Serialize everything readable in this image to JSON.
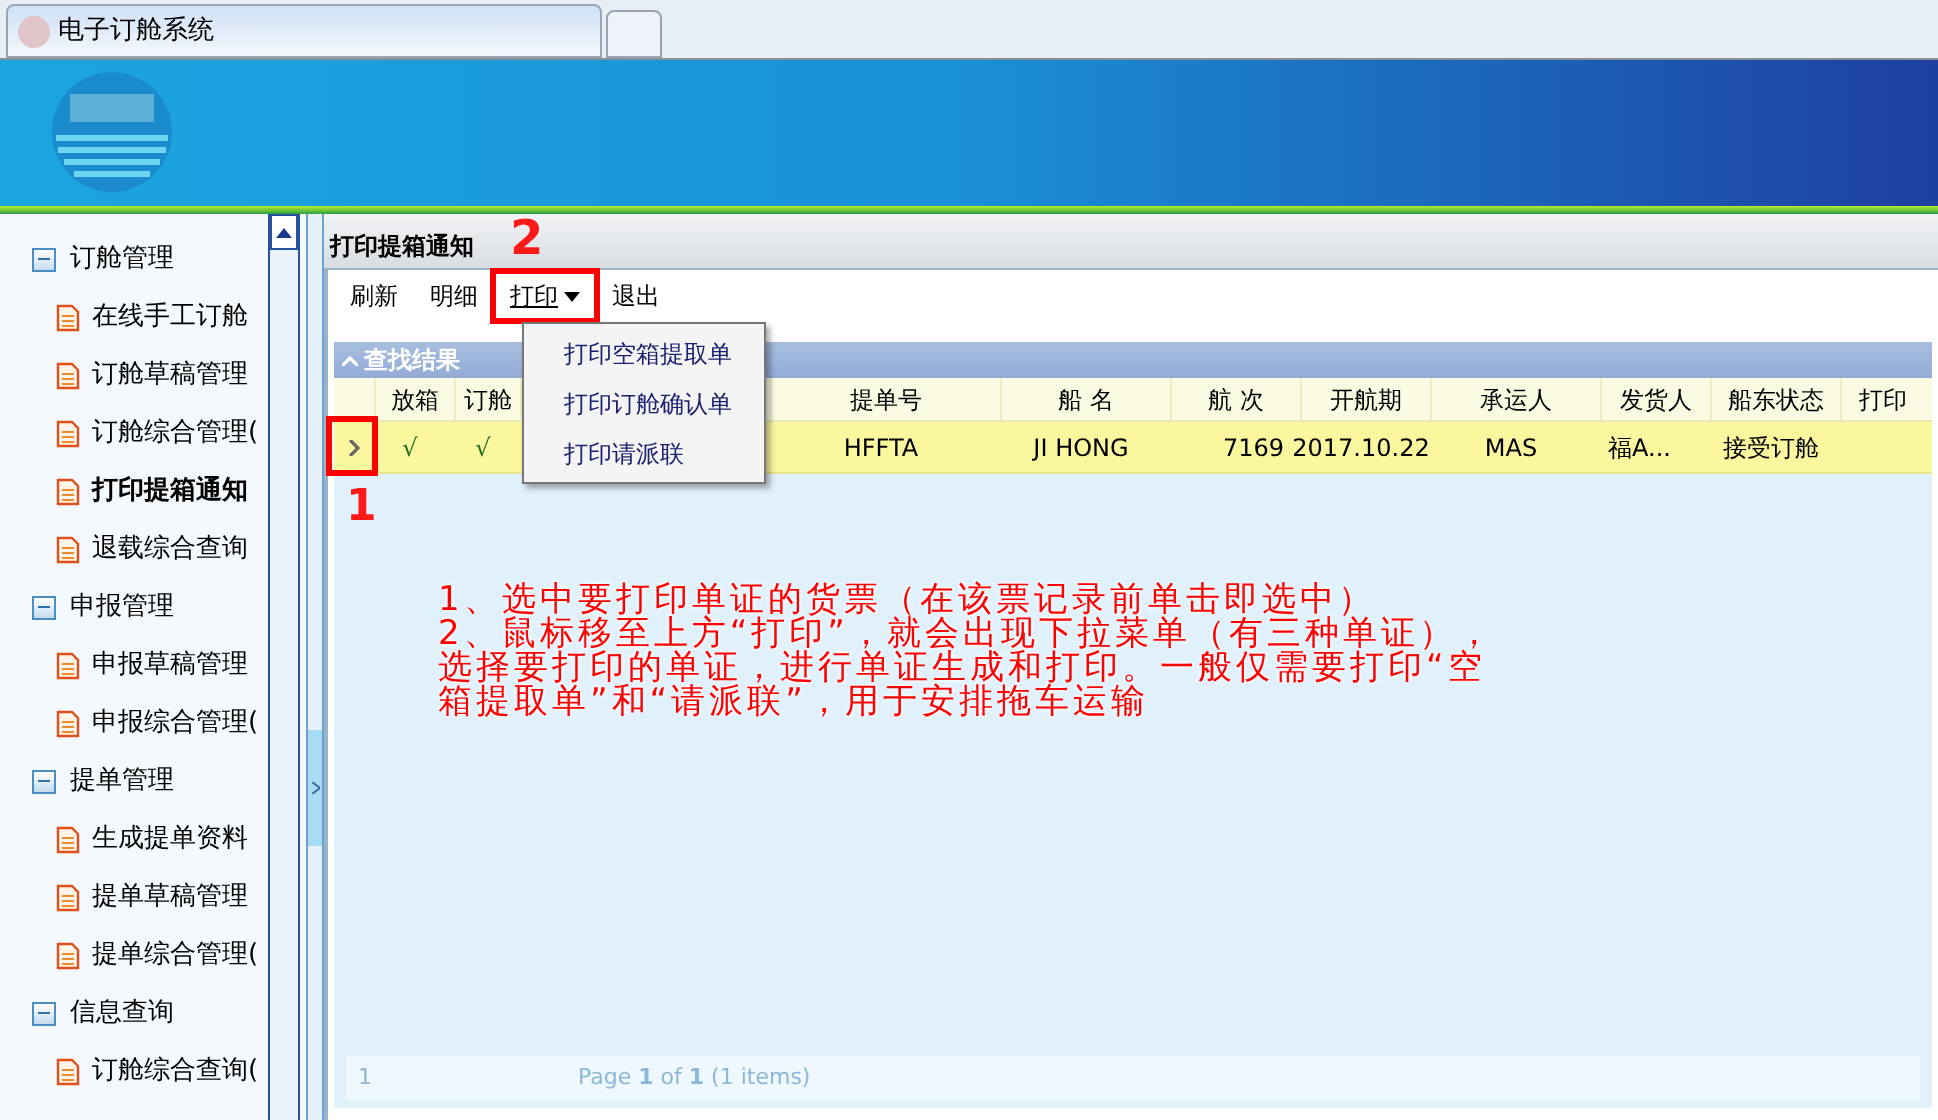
{
  "browser_tab": {
    "title": "电子订舱系统"
  },
  "sidebar": {
    "groups": [
      {
        "label": "订舱管理",
        "expanded": true,
        "children": [
          {
            "label": "在线手工订舱",
            "selected": false
          },
          {
            "label": "订舱草稿管理",
            "selected": false
          },
          {
            "label": "订舱综合管理(",
            "selected": false
          },
          {
            "label": "打印提箱通知",
            "selected": true
          },
          {
            "label": "退载综合查询",
            "selected": false
          }
        ]
      },
      {
        "label": "申报管理",
        "expanded": true,
        "children": [
          {
            "label": "申报草稿管理",
            "selected": false
          },
          {
            "label": "申报综合管理(",
            "selected": false
          }
        ]
      },
      {
        "label": "提单管理",
        "expanded": true,
        "children": [
          {
            "label": "生成提单资料",
            "selected": false
          },
          {
            "label": "提单草稿管理",
            "selected": false
          },
          {
            "label": "提单综合管理(",
            "selected": false
          }
        ]
      },
      {
        "label": "信息查询",
        "expanded": true,
        "children": [
          {
            "label": "订舱综合查询(",
            "selected": false
          }
        ]
      }
    ]
  },
  "panel": {
    "title": "打印提箱通知",
    "toolbar": [
      {
        "label": "刷新",
        "kind": "button"
      },
      {
        "label": "明细",
        "kind": "button"
      },
      {
        "label": "打印",
        "kind": "dropdown",
        "callout": "2"
      },
      {
        "label": "退出",
        "kind": "button"
      }
    ],
    "menu": {
      "items": [
        "打印空箱提取单",
        "打印订舱确认单",
        "打印请派联"
      ]
    },
    "results_title": "查找结果",
    "table": {
      "columns": [
        "放箱",
        "订舱",
        "",
        "提单号",
        "船 名",
        "航 次",
        "开航期",
        "承运人",
        "发货人",
        "船东状态",
        "打印"
      ],
      "rows": [
        {
          "selected": true,
          "callout": "1",
          "cells": [
            "√",
            "√",
            "",
            "HFFTA",
            "JI HONG",
            "7169",
            "2017.10.22",
            "MAS",
            "福A...",
            "接受订舱",
            ""
          ]
        }
      ]
    },
    "notes": [
      "1、选中要打印单证的货票（在该票记录前单击即选中）",
      "2、鼠标移至上方“打印”，就会出现下拉菜单（有三种单证），选择要打印的单证，进行单证生成和打印。一般仅需要打印“空箱提取单”和“请派联”，用于安排拖车运输"
    ],
    "pager": {
      "first": "1",
      "status": "Page **1** of **1** (1 items)"
    }
  }
}
